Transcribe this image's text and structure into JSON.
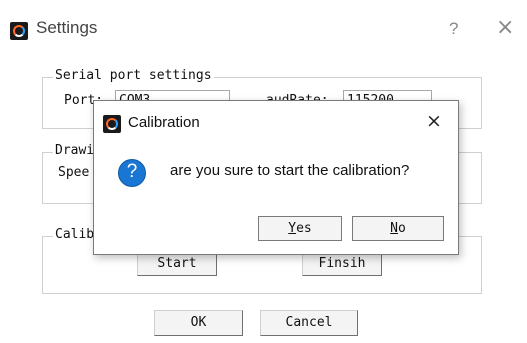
{
  "window": {
    "title": "Settings",
    "help_glyph": "?",
    "close_glyph": "×"
  },
  "serial": {
    "group_label": "Serial port settings",
    "port_label": "Port:",
    "port_value": "COM3",
    "baud_label": "audRate:",
    "baud_value": "115200"
  },
  "drawing": {
    "group_label": "Drawi",
    "speed_label": "Spee"
  },
  "calibration": {
    "group_label": "Calib",
    "start_label": "Start",
    "finish_label": "Finsih"
  },
  "footer": {
    "ok_label": "OK",
    "cancel_label": "Cancel"
  },
  "dialog": {
    "title": "Calibration",
    "close_glyph": "×",
    "icon_glyph": "?",
    "message": "are you sure to start the calibration?",
    "yes_mnemonic": "Y",
    "yes_rest": "es",
    "no_mnemonic": "N",
    "no_rest": "o"
  },
  "icons": {
    "app": "app-logo-icon",
    "question": "question-icon"
  }
}
